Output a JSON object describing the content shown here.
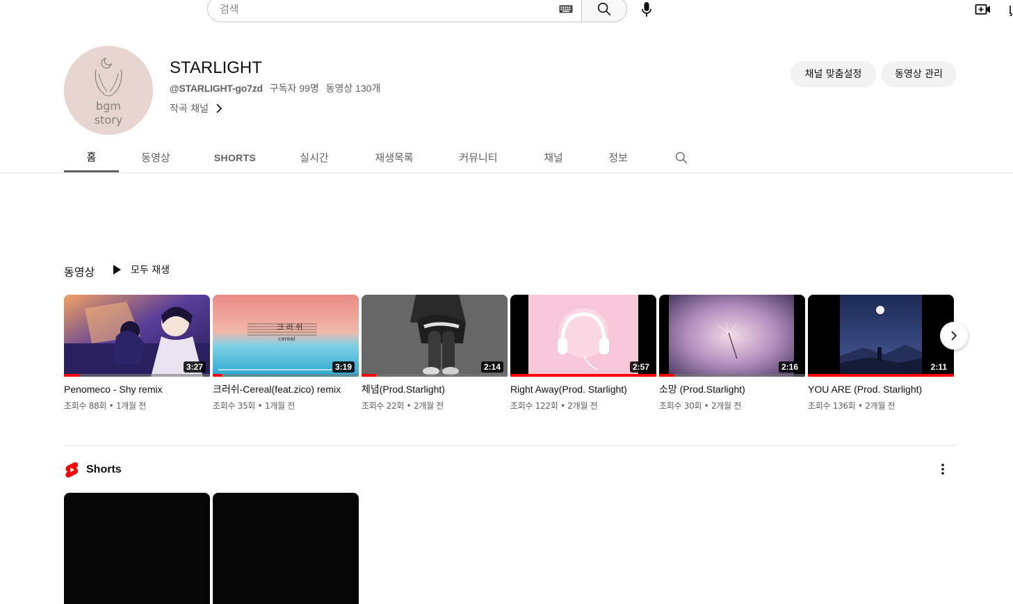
{
  "search": {
    "placeholder": "검색"
  },
  "channel": {
    "name": "STARLIGHT",
    "handle": "@STARLIGHT-go7zd",
    "subscribers": "구독자 99명",
    "video_count": "동영상 130개",
    "description": "작곡 채널",
    "avatar_text_line1": "bgm",
    "avatar_text_line2": "story",
    "buttons": {
      "customize": "채널 맞춤설정",
      "manage": "동영상 관리"
    }
  },
  "tabs": [
    "홈",
    "동영상",
    "SHORTS",
    "실시간",
    "재생목록",
    "커뮤니티",
    "채널",
    "정보"
  ],
  "videos_section": {
    "title": "동영상",
    "play_all": "모두 재생",
    "videos": [
      {
        "title": "Penomeco - Shy remix",
        "meta": "조회수 88회 • 1개월 전",
        "duration": "3:27",
        "progress": 0.1
      },
      {
        "title": "크러쉬-Cereal(feat.zico) remix",
        "meta": "조회수 35회 • 1개월 전",
        "duration": "3:19",
        "progress": 0.06,
        "thumb_text": "크 러 쉬",
        "thumb_subtext": "cereal"
      },
      {
        "title": "체념(Prod.Starlight)",
        "meta": "조회수 22회 • 2개월 전",
        "duration": "2:14",
        "progress": 0.1
      },
      {
        "title": "Right Away(Prod. Starlight)",
        "meta": "조회수 122회 • 2개월 전",
        "duration": "2:57",
        "progress": 1.0
      },
      {
        "title": "소망 (Prod.Starlight)",
        "meta": "조회수 30회 • 2개월 전",
        "duration": "2:16",
        "progress": 0.1
      },
      {
        "title": "YOU ARE (Prod. Starlight)",
        "meta": "조회수 136회 • 2개월 전",
        "duration": "2:11",
        "progress": 1.0
      }
    ]
  },
  "shorts_section": {
    "title": "Shorts"
  },
  "colors": {
    "accent_red": "#ff0000",
    "text_primary": "#0f0f0f",
    "text_secondary": "#606060"
  },
  "icons": [
    "keyboard-icon",
    "search-icon",
    "mic-icon",
    "create-video-icon",
    "chevron-right-icon",
    "play-icon",
    "shorts-logo-icon",
    "more-vert-icon",
    "tab-search-icon"
  ]
}
